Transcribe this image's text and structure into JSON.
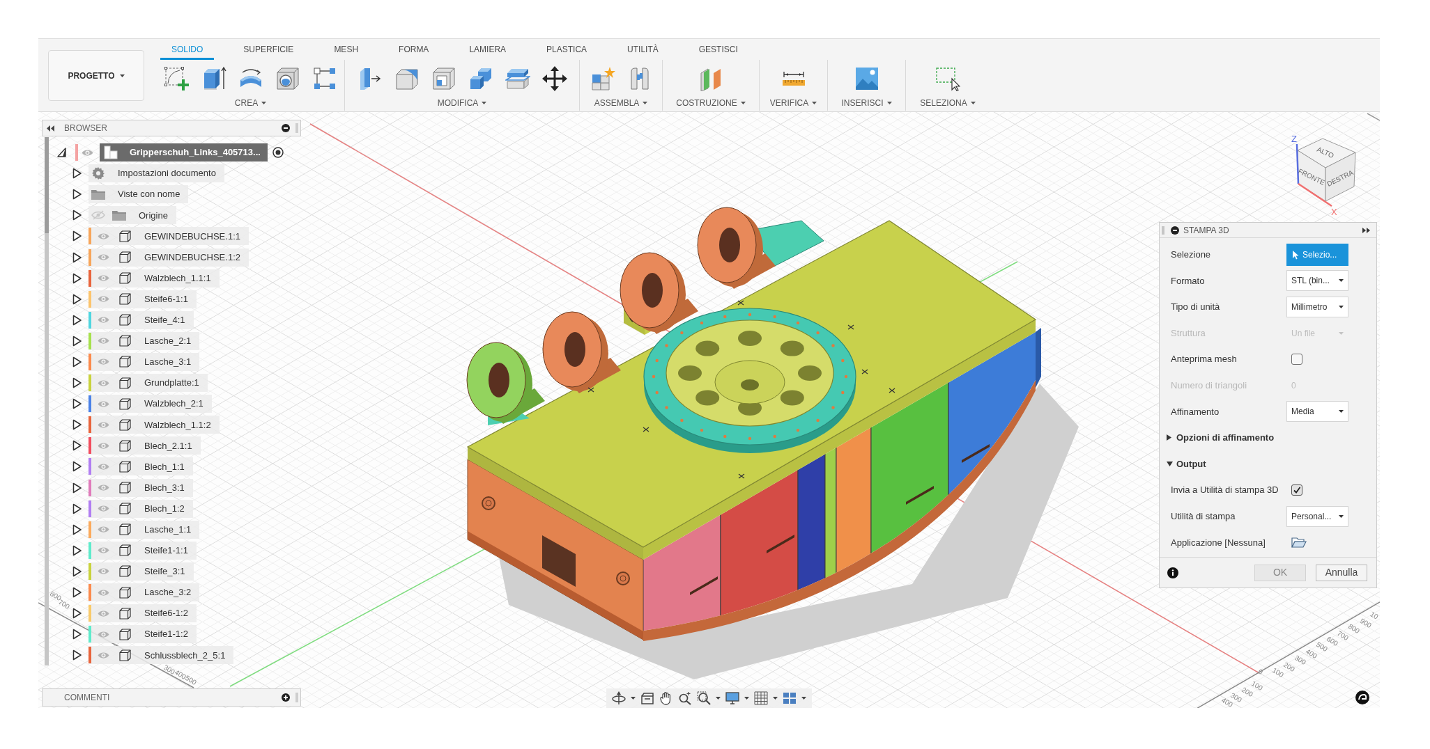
{
  "toolbar": {
    "project_button": {
      "label": "PROGETTO"
    },
    "tabs": [
      {
        "label": "SOLIDO",
        "selected": true
      },
      {
        "label": "SUPERFICIE",
        "selected": false
      },
      {
        "label": "MESH",
        "selected": false
      },
      {
        "label": "FORMA",
        "selected": false
      },
      {
        "label": "LAMIERA",
        "selected": false
      },
      {
        "label": "PLASTICA",
        "selected": false
      },
      {
        "label": "UTILITÀ",
        "selected": false
      },
      {
        "label": "GESTISCI",
        "selected": false
      }
    ],
    "groups": [
      {
        "label": "CREA"
      },
      {
        "label": "MODIFICA"
      },
      {
        "label": "ASSEMBLA"
      },
      {
        "label": "COSTRUZIONE"
      },
      {
        "label": "VERIFICA"
      },
      {
        "label": "INSERISCI"
      },
      {
        "label": "SELEZIONA"
      }
    ]
  },
  "browser": {
    "title": "BROWSER",
    "tree": [
      {
        "kind": "component",
        "label": "Gripperschuh_Links_405713...",
        "color": "#f4a3a3",
        "visible": true,
        "expanded": true,
        "active": true,
        "children": [
          {
            "kind": "settings",
            "label": "Impostazioni documento",
            "expanded": false
          },
          {
            "kind": "folder",
            "label": "Viste con nome",
            "expanded": false
          },
          {
            "kind": "origin",
            "label": "Origine",
            "expanded": false,
            "visible": false
          },
          {
            "kind": "body",
            "label": "GEWINDEBUCHSE.1:1",
            "color": "#f7a55a",
            "visible": true,
            "expanded": false
          },
          {
            "kind": "body",
            "label": "GEWINDEBUCHSE.1:2",
            "color": "#f7a55a",
            "visible": true,
            "expanded": false
          },
          {
            "kind": "body",
            "label": "Walzblech_1.1:1",
            "color": "#e8643c",
            "visible": true,
            "expanded": false
          },
          {
            "kind": "body",
            "label": "Steife6-1:1",
            "color": "#fcc46c",
            "visible": true,
            "expanded": false
          },
          {
            "kind": "body",
            "label": "Steife_4:1",
            "color": "#4fd6e0",
            "visible": true,
            "expanded": false
          },
          {
            "kind": "body",
            "label": "Lasche_2:1",
            "color": "#a6e14c",
            "visible": true,
            "expanded": false
          },
          {
            "kind": "body",
            "label": "Lasche_3:1",
            "color": "#fb8a4c",
            "visible": true,
            "expanded": false
          },
          {
            "kind": "body",
            "label": "Grundplatte:1",
            "color": "#c9d23c",
            "visible": true,
            "expanded": false
          },
          {
            "kind": "body",
            "label": "Walzblech_2:1",
            "color": "#4b82e8",
            "visible": true,
            "expanded": false
          },
          {
            "kind": "body",
            "label": "Walzblech_1.1:2",
            "color": "#e8643c",
            "visible": true,
            "expanded": false
          },
          {
            "kind": "body",
            "label": "Blech_2.1:1",
            "color": "#f24d5e",
            "visible": true,
            "expanded": false
          },
          {
            "kind": "body",
            "label": "Blech_1:1",
            "color": "#b17ef2",
            "visible": true,
            "expanded": false
          },
          {
            "kind": "body",
            "label": "Blech_3:1",
            "color": "#e07bbb",
            "visible": true,
            "expanded": false
          },
          {
            "kind": "body",
            "label": "Blech_1:2",
            "color": "#b17ef2",
            "visible": true,
            "expanded": false
          },
          {
            "kind": "body",
            "label": "Lasche_1:1",
            "color": "#fbaa5c",
            "visible": true,
            "expanded": false
          },
          {
            "kind": "body",
            "label": "Steife1-1:1",
            "color": "#5eebcb",
            "visible": true,
            "expanded": false
          },
          {
            "kind": "body",
            "label": "Steife_3:1",
            "color": "#c9d23c",
            "visible": true,
            "expanded": false
          },
          {
            "kind": "body",
            "label": "Lasche_3:2",
            "color": "#fb8a4c",
            "visible": true,
            "expanded": false
          },
          {
            "kind": "body",
            "label": "Steife6-1:2",
            "color": "#f9ca6a",
            "visible": true,
            "expanded": false
          },
          {
            "kind": "body",
            "label": "Steife1-1:2",
            "color": "#5eebcb",
            "visible": true,
            "expanded": false
          },
          {
            "kind": "body",
            "label": "Schlussblech_2_5:1",
            "color": "#e8643c",
            "visible": true,
            "expanded": false
          }
        ]
      }
    ]
  },
  "comments": {
    "title": "COMMENTI"
  },
  "viewport": {
    "view_cube": {
      "faces": [
        {
          "label": "ALTO"
        },
        {
          "label": "FRONTE"
        },
        {
          "label": "DESTRA"
        }
      ],
      "axes": [
        {
          "label": "Z",
          "color": "#5a6fe0"
        },
        {
          "label": "X",
          "color": "#f07070"
        }
      ]
    },
    "rulers": [
      {
        "labels": [
          "0",
          "100",
          "200",
          "300",
          "400",
          "500",
          "600",
          "700",
          "800",
          "900",
          "10"
        ]
      },
      {
        "labels": [
          "100",
          "200",
          "300",
          "400"
        ]
      },
      {
        "labels": [
          "800",
          "700"
        ]
      },
      {
        "labels": [
          "300",
          "400",
          "500"
        ]
      }
    ]
  },
  "print_panel": {
    "title": "STAMPA 3D",
    "rows": [
      {
        "kind": "select",
        "label": "Selezione",
        "value": "Selezio...",
        "disabled": false
      },
      {
        "kind": "dropdown",
        "label": "Formato",
        "value": "STL (bin...",
        "disabled": false
      },
      {
        "kind": "dropdown",
        "label": "Tipo di unità",
        "value": "Millimetro",
        "disabled": false
      },
      {
        "kind": "dropdown",
        "label": "Struttura",
        "value": "Un file",
        "disabled": true
      },
      {
        "kind": "checkbox",
        "label": "Anteprima mesh",
        "checked": false,
        "disabled": false
      },
      {
        "kind": "readout",
        "label": "Numero di triangoli",
        "value": "0",
        "disabled": true
      },
      {
        "kind": "dropdown",
        "label": "Affinamento",
        "value": "Media",
        "disabled": false
      }
    ],
    "sections": [
      {
        "label": "Opzioni di affinamento",
        "expanded": false
      },
      {
        "label": "Output",
        "expanded": true,
        "rows": [
          {
            "kind": "checkbox",
            "label": "Invia a Utilità di stampa 3D",
            "checked": true,
            "disabled": false
          },
          {
            "kind": "dropdown",
            "label": "Utilità di stampa",
            "value": "Personal...",
            "disabled": false
          },
          {
            "kind": "file",
            "label": "Applicazione [Nessuna]",
            "disabled": false
          }
        ]
      }
    ],
    "buttons": [
      {
        "label": "OK",
        "disabled": true
      },
      {
        "label": "Annulla",
        "disabled": false
      }
    ]
  }
}
